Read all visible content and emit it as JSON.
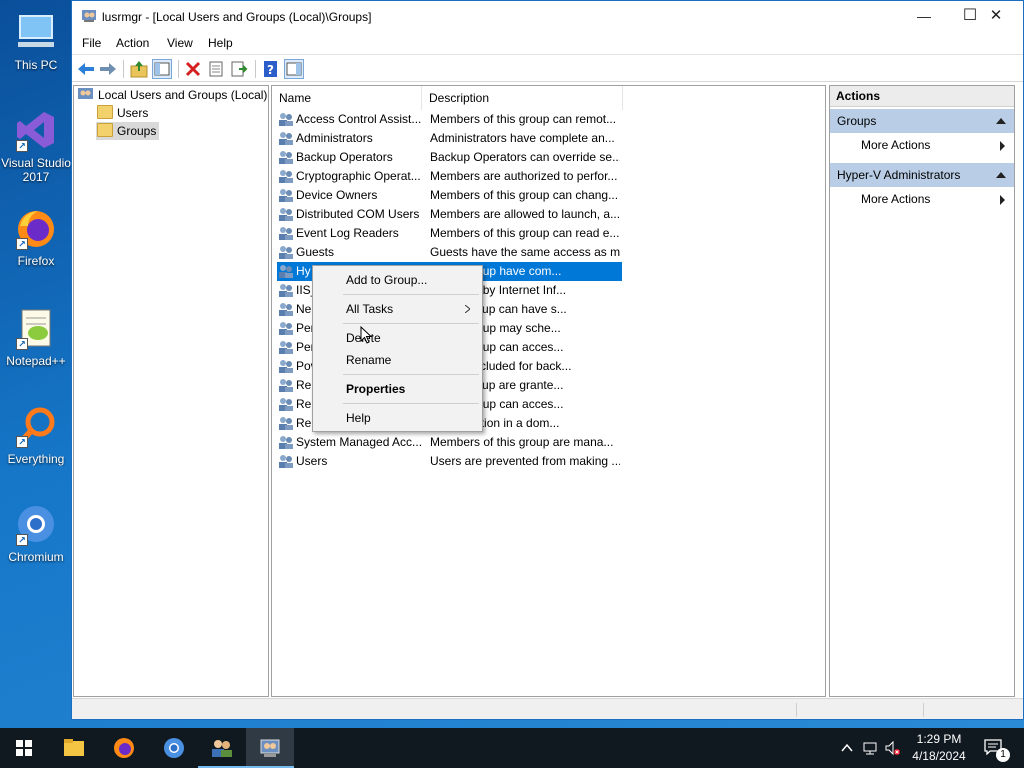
{
  "desktop": {
    "icons": [
      {
        "label": "This PC"
      },
      {
        "label": "Visual Studio 2017"
      },
      {
        "label": "Firefox"
      },
      {
        "label": "Notepad++"
      },
      {
        "label": "Everything"
      },
      {
        "label": "Chromium"
      }
    ]
  },
  "window": {
    "title": "lusrmgr - [Local Users and Groups (Local)\\Groups]",
    "controls": {
      "minimize": "—",
      "maximize": "☐",
      "close": "✕"
    }
  },
  "menu": {
    "file": "File",
    "action": "Action",
    "view": "View",
    "help": "Help"
  },
  "tree": {
    "root": "Local Users and Groups (Local)",
    "items": [
      "Users",
      "Groups"
    ],
    "selected": "Groups"
  },
  "list": {
    "columns": {
      "name": "Name",
      "description": "Description"
    },
    "rows": [
      {
        "name": "Access Control Assist...",
        "desc": "Members of this group can remot..."
      },
      {
        "name": "Administrators",
        "desc": "Administrators have complete an..."
      },
      {
        "name": "Backup Operators",
        "desc": "Backup Operators can override se..."
      },
      {
        "name": "Cryptographic Operat...",
        "desc": "Members are authorized to perfor..."
      },
      {
        "name": "Device Owners",
        "desc": "Members of this group can chang..."
      },
      {
        "name": "Distributed COM Users",
        "desc": "Members are allowed to launch, a..."
      },
      {
        "name": "Event Log Readers",
        "desc": "Members of this group can read e..."
      },
      {
        "name": "Guests",
        "desc": "Guests have the same access as m..."
      },
      {
        "name": "Hy",
        "desc": "of this group have com..."
      },
      {
        "name": "IIS_",
        "desc": "oup used by Internet Inf..."
      },
      {
        "name": "Ne",
        "desc": "in this group can have s..."
      },
      {
        "name": "Per",
        "desc": "of this group may sche..."
      },
      {
        "name": "Per",
        "desc": "of this group can acces..."
      },
      {
        "name": "Pov",
        "desc": "ers are included for back..."
      },
      {
        "name": "Rer",
        "desc": "in this group are grante..."
      },
      {
        "name": "Rer",
        "desc": "of this group can acces..."
      },
      {
        "name": "Rep",
        "desc": "ile replication in a dom..."
      },
      {
        "name": "System Managed Acc...",
        "desc": "Members of this group are mana..."
      },
      {
        "name": "Users",
        "desc": "Users are prevented from making ..."
      }
    ],
    "selected_index": 8
  },
  "actions": {
    "header": "Actions",
    "sections": [
      {
        "title": "Groups",
        "items": [
          "More Actions"
        ]
      },
      {
        "title": "Hyper-V Administrators",
        "items": [
          "More Actions"
        ]
      }
    ]
  },
  "context_menu": {
    "add_to_group": "Add to Group...",
    "all_tasks": "All Tasks",
    "delete": "Delete",
    "rename": "Rename",
    "properties": "Properties",
    "help": "Help"
  },
  "clock": {
    "time": "1:29 PM",
    "date": "4/18/2024"
  },
  "notifications": {
    "count": "1"
  },
  "colors": {
    "accent": "#0078d7",
    "actions_section": "#b9cee6",
    "taskbar": "#101820"
  }
}
